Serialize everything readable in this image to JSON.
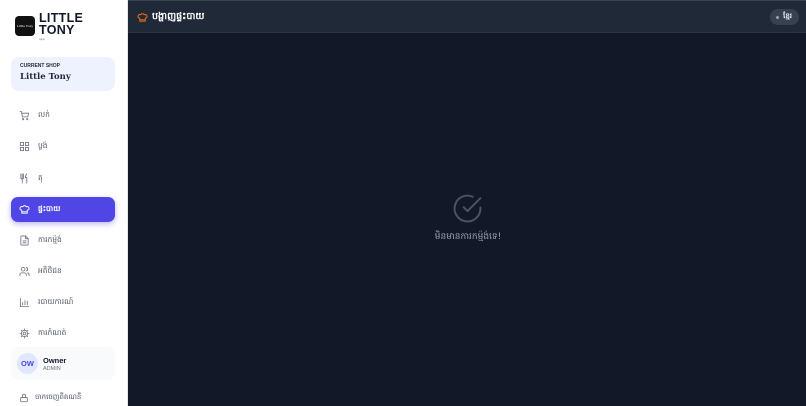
{
  "brand": {
    "logo_text": "Little Tony",
    "name_line1": "LITTLE",
    "name_line2": "TONY",
    "tagline": "app"
  },
  "shop": {
    "label": "CURRENT SHOP",
    "name": "Little Tony"
  },
  "nav": [
    {
      "label": "លក់",
      "icon": "cart-icon"
    },
    {
      "label": "ប្លង់",
      "icon": "grid-icon"
    },
    {
      "label": "តុ",
      "icon": "utensils-icon"
    },
    {
      "label": "ផ្ទះបាយ",
      "icon": "chef-hat-icon",
      "active": true
    },
    {
      "label": "ការកម្ម៉ង់",
      "icon": "document-icon"
    },
    {
      "label": "អតិថិជន",
      "icon": "users-icon"
    },
    {
      "label": "របាយការណ៍",
      "icon": "chart-icon"
    },
    {
      "label": "ការកំណត់",
      "icon": "gear-icon"
    }
  ],
  "user": {
    "initials": "OW",
    "name": "Owner",
    "role": "ADMIN"
  },
  "logout": {
    "label": "ចាកចេញពីគណនី"
  },
  "topbar": {
    "title": "បង្ហាញផ្ទះបាយ",
    "lang_label": "ខ្មែរ"
  },
  "empty_state": {
    "message": "មិនមានការកម្ម៉ង់ទេ!"
  },
  "colors": {
    "accent": "#4f46e5",
    "background": "#111827",
    "topbar": "#1f2937",
    "chef_icon": "#f97316"
  }
}
